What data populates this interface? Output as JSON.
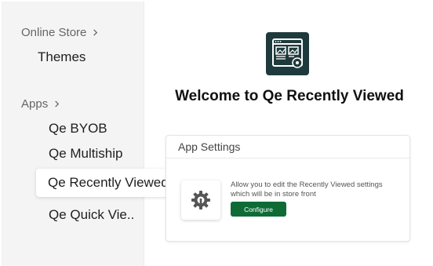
{
  "sidebar": {
    "sections": [
      {
        "label": "Online Store",
        "items": [
          "Themes"
        ]
      },
      {
        "label": "Apps",
        "items": [
          "Qe BYOB",
          "Qe Multiship",
          "Qe Recently Viewed",
          "Qe Quick Vie.."
        ]
      }
    ],
    "active_item": "Qe Recently Viewed"
  },
  "main": {
    "logo_icon": "app-logo-icon",
    "title": "Welcome to Qe Recently Viewed",
    "card": {
      "header": "App Settings",
      "icon": "gear-wrench-icon",
      "description": "Allow you to edit the Recently Viewed settings which will be in store front",
      "button_label": "Configure"
    }
  },
  "colors": {
    "sidebar_bg": "#f4f4f4",
    "logo_tile": "#1f3a3d",
    "button": "#0f6b36"
  }
}
